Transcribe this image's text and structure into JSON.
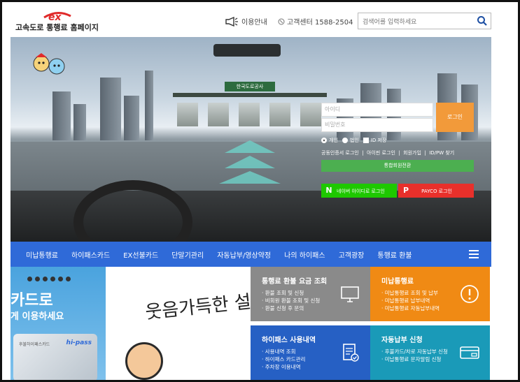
{
  "header": {
    "logo_mark": "ex",
    "logo_text": "고속도로 통행료 홈페이지",
    "info_label": "이용안내",
    "call_label": "고객센터 1588-2504",
    "search_placeholder": "검색어를 입력하세요"
  },
  "hero": {
    "toll_sign": "한국도로공사"
  },
  "login": {
    "id_placeholder": "아이디",
    "pw_placeholder": "비밀번호",
    "login_button": "로그인",
    "opt_personal": "개인",
    "opt_corporate": "법인",
    "opt_save_id": "ID 저장",
    "links": [
      "공동인증서 로그인",
      "아이핀 로그인",
      "회원가입",
      "ID/PW 찾기"
    ],
    "integrated_button": "통합회원전환",
    "naver_button": "네이버 아이디로 로그인",
    "naver_letter": "N",
    "payco_button": "PAYCO 로그인",
    "payco_letter": "P"
  },
  "menu": [
    "미납통행료",
    "하이패스카드",
    "EX선불카드",
    "단말기관리",
    "자동납부/영상약정",
    "나의 하이패스",
    "고객광장",
    "통행료 환불"
  ],
  "banner1": {
    "line1": "카드로",
    "line2": "게 이용하세요",
    "card_brand": "hi-pass",
    "card_small": "후불하이패스카드"
  },
  "banner2": {
    "calligraphy": "웃음가득한 설날"
  },
  "tiles": [
    {
      "title": "통행료 환불 요금 조회",
      "items": [
        "환불 조회 및 신청",
        "비회원 환불 조회 및 신청",
        "환불 신청 후 문의"
      ],
      "color": "#8a8a8a"
    },
    {
      "title": "미납통행료",
      "items": [
        "미납통행료 조회 및 납부",
        "미납통행료 납부내역",
        "미납통행료 자동납부내역"
      ],
      "color": "#f08a14"
    },
    {
      "title": "하이패스 사용내역",
      "items": [
        "사용내역 조회",
        "하이패스 카드관리",
        "주차장 이용내역"
      ],
      "color": "#2660c4"
    },
    {
      "title": "자동납부 신청",
      "items": [
        "후불카드/차로 자동납부 신청",
        "미납통행료 문자알림 신청"
      ],
      "color": "#1a9ab8"
    }
  ],
  "colors": {
    "accent": "#2f6ad8",
    "logo_red": "#e02a2a",
    "login_orange": "#f29a3a",
    "naver": "#1ec800",
    "payco": "#e8302b"
  }
}
